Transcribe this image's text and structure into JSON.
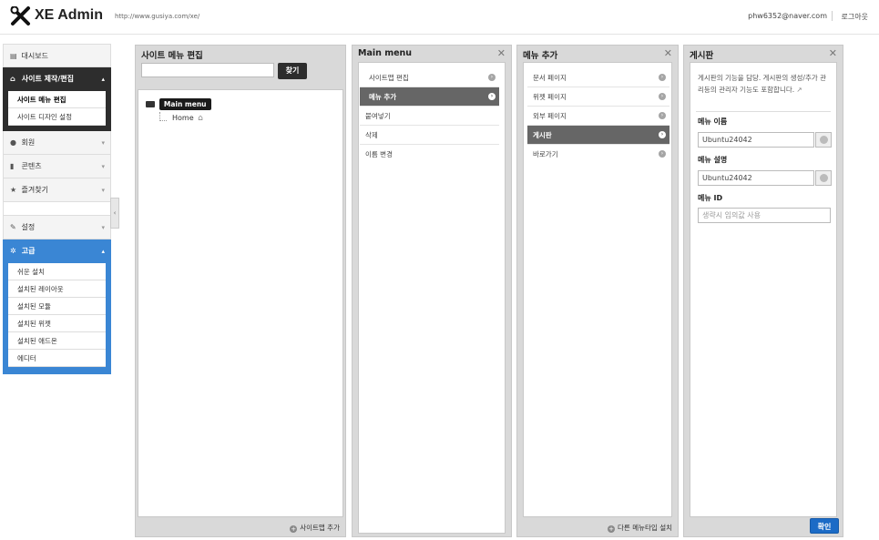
{
  "header": {
    "brand": "XE Admin",
    "site_url": "http://www.gusiya.com/xe/",
    "user_email": "phw6352@naver.com",
    "logout": "로그아웃"
  },
  "sidebar": {
    "items": [
      {
        "label": "대시보드",
        "icon": "dashboard-icon"
      },
      {
        "label": "사이트 제작/편집",
        "icon": "home-icon"
      },
      {
        "label": "회원",
        "icon": "user-icon"
      },
      {
        "label": "콘텐츠",
        "icon": "document-icon"
      },
      {
        "label": "즐겨찾기",
        "icon": "star-icon"
      },
      {
        "label": "설정",
        "icon": "wrench-icon"
      },
      {
        "label": "고급",
        "icon": "gear-icon"
      }
    ],
    "site_sub": [
      "사이트 메뉴 편집",
      "사이트 디자인 설정"
    ],
    "advanced_sub": [
      "쉬운 설치",
      "설치된 레이아웃",
      "설치된 모듈",
      "설치된 위젯",
      "설치된 애드온",
      "에디터"
    ]
  },
  "panel1": {
    "title": "사이트 메뉴 편집",
    "search_placeholder": "",
    "find_btn": "찾기",
    "tree_root": "Main menu",
    "tree_child": "Home",
    "footer": "사이트맵 추가"
  },
  "panel2": {
    "title": "Main menu",
    "items": [
      "사이트맵 편집",
      "메뉴 추가",
      "붙여넣기",
      "삭제",
      "이름 변경"
    ]
  },
  "panel3": {
    "title": "메뉴 추가",
    "items": [
      "문서 페이지",
      "위젯 페이지",
      "외부 페이지",
      "게시판",
      "바로가기"
    ],
    "footer": "다른 메뉴타입 설치"
  },
  "panel4": {
    "title": "게시판",
    "description": "게시판의 기능을 담당. 게시판의 생성/추가 관리등의 관리자 기능도 포함합니다.",
    "name_label": "메뉴 이름",
    "name_value": "Ubuntu24042",
    "desc_label": "메뉴 설명",
    "desc_value": "Ubuntu24042",
    "id_label": "메뉴 ID",
    "id_placeholder": "생략시 임의값 사용",
    "confirm": "확인"
  },
  "colors": {
    "dark": "#2d2d2d",
    "accent_blue": "#3a86d4",
    "button_blue": "#1c6bc6",
    "selected_row": "#666666"
  }
}
